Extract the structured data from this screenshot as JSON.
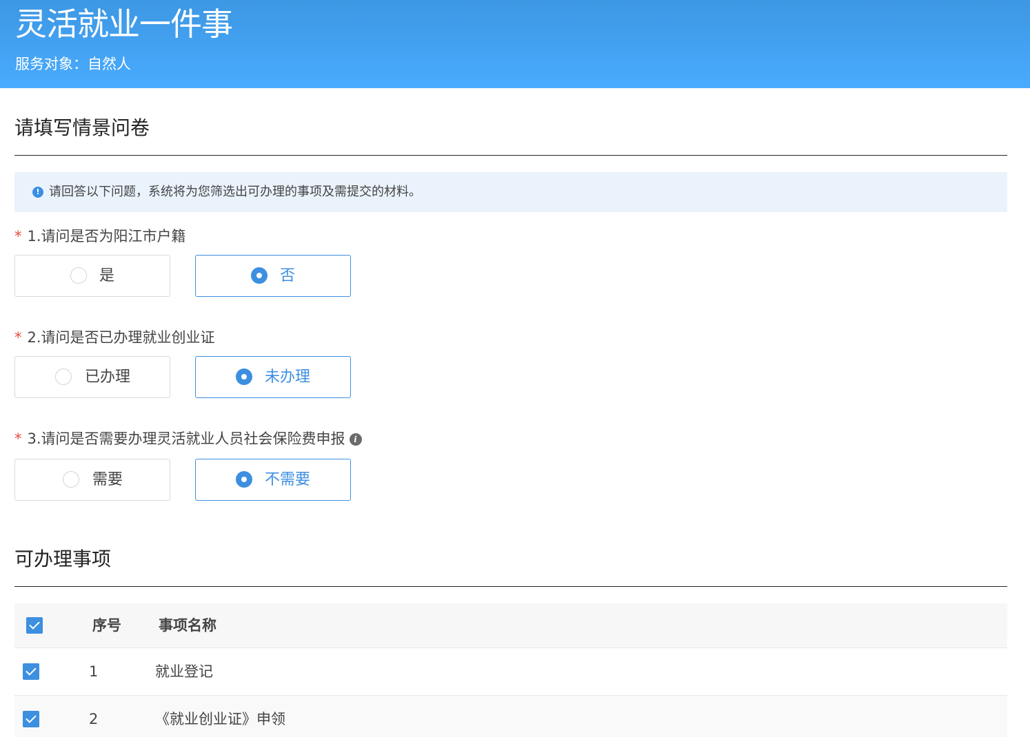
{
  "header": {
    "title": "灵活就业一件事",
    "subtitle": "服务对象：自然人"
  },
  "questionnaire": {
    "title": "请填写情景问卷",
    "notice": "请回答以下问题，系统将为您筛选出可办理的事项及需提交的材料。",
    "questions": [
      {
        "required": "*",
        "label": "1.请问是否为阳江市户籍",
        "options": [
          "是",
          "否"
        ],
        "selected": "否"
      },
      {
        "required": "*",
        "label": "2.请问是否已办理就业创业证",
        "options": [
          "已办理",
          "未办理"
        ],
        "selected": "未办理"
      },
      {
        "required": "*",
        "label": "3.请问是否需要办理灵活就业人员社会保险费申报",
        "options": [
          "需要",
          "不需要"
        ],
        "selected": "不需要",
        "info_icon": "info-icon"
      }
    ]
  },
  "items_section": {
    "title": "可办理事项",
    "columns": [
      "序号",
      "事项名称"
    ],
    "select_all_checked": true,
    "rows": [
      {
        "index": "1",
        "name": "就业登记",
        "checked": true
      },
      {
        "index": "2",
        "name": "《就业创业证》申领",
        "checked": true
      }
    ]
  },
  "colors": {
    "header_gradient_top": "#3d97e3",
    "header_gradient_bottom": "#49abff",
    "accent": "#3d8fe0",
    "notice_bg": "#eaf3fc",
    "required_star": "#e64a3b"
  }
}
